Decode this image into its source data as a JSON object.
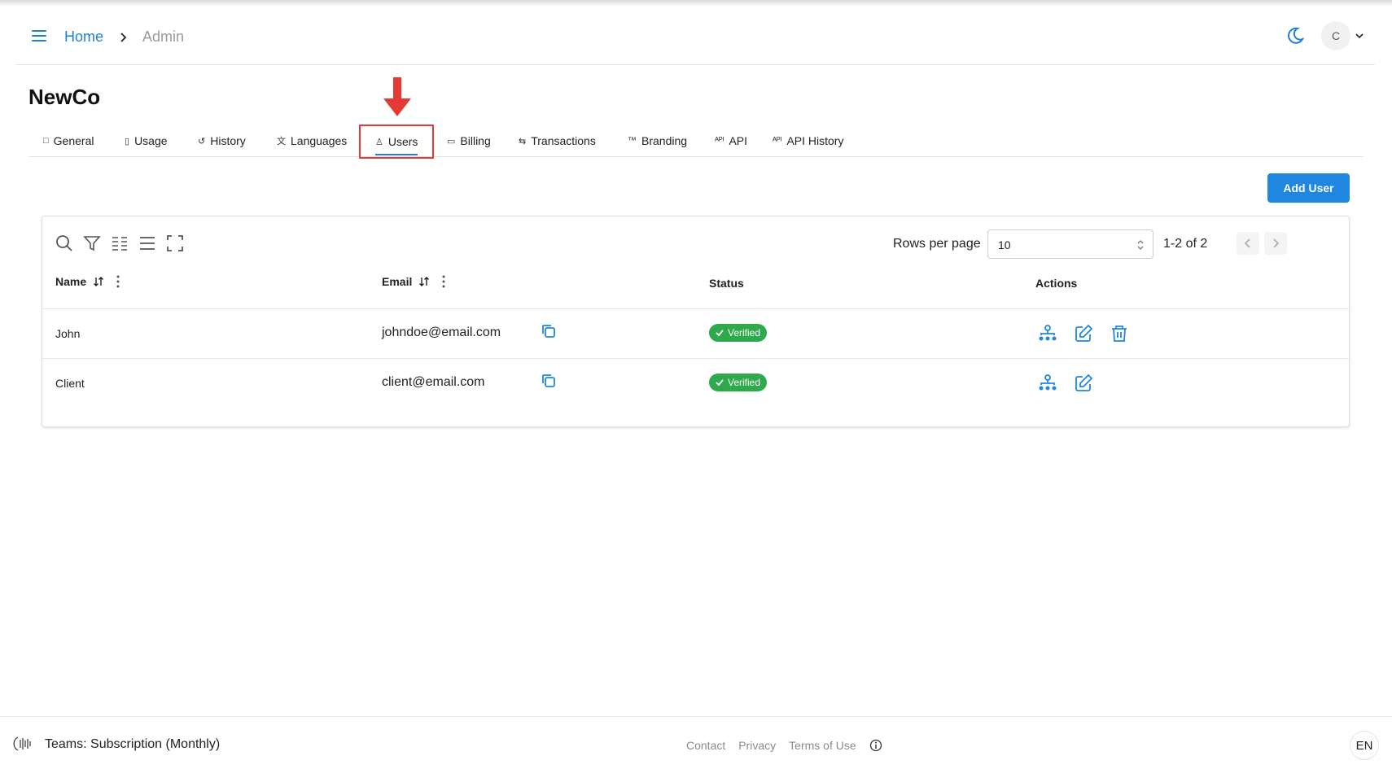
{
  "header": {
    "breadcrumb": {
      "home": "Home",
      "current": "Admin"
    },
    "avatar_initial": "C",
    "icons": {
      "menu": "hamburger-icon",
      "theme": "moon-icon",
      "caret": "chevron-down-icon"
    }
  },
  "page": {
    "title": "NewCo"
  },
  "tabs": [
    {
      "label": "General",
      "icon": "□"
    },
    {
      "label": "Usage",
      "icon": "▯"
    },
    {
      "label": "History",
      "icon": "↺"
    },
    {
      "label": "Languages",
      "icon": "文"
    },
    {
      "label": "Users",
      "icon": "♙",
      "active": true
    },
    {
      "label": "Billing",
      "icon": "▭"
    },
    {
      "label": "Transactions",
      "icon": "⇆"
    },
    {
      "label": "Branding",
      "icon": "™"
    },
    {
      "label": "API",
      "icon": "ᴬᴾᴵ"
    },
    {
      "label": "API History",
      "icon": "ᴬᴾᴵ"
    }
  ],
  "toolbar": {
    "add_user_label": "Add User"
  },
  "table": {
    "rows_per_page_label": "Rows per page",
    "rows_per_page_value": "10",
    "range_text": "1-2 of 2",
    "columns": {
      "name": "Name",
      "email": "Email",
      "status": "Status",
      "actions": "Actions"
    },
    "rows": [
      {
        "name": "John",
        "email": "johndoe@email.com",
        "status": "Verified",
        "actions": [
          "org-icon",
          "edit-icon",
          "trash-icon"
        ]
      },
      {
        "name": "Client",
        "email": "client@email.com",
        "status": "Verified",
        "actions": [
          "org-icon",
          "edit-icon"
        ]
      }
    ]
  },
  "footer": {
    "plan": "Teams: Subscription (Monthly)",
    "links": {
      "contact": "Contact",
      "privacy": "Privacy",
      "terms": "Terms of Use"
    },
    "language": "EN"
  },
  "colors": {
    "accent": "#1f87e0",
    "success": "#2eaa4c",
    "highlight": "#e53935"
  }
}
